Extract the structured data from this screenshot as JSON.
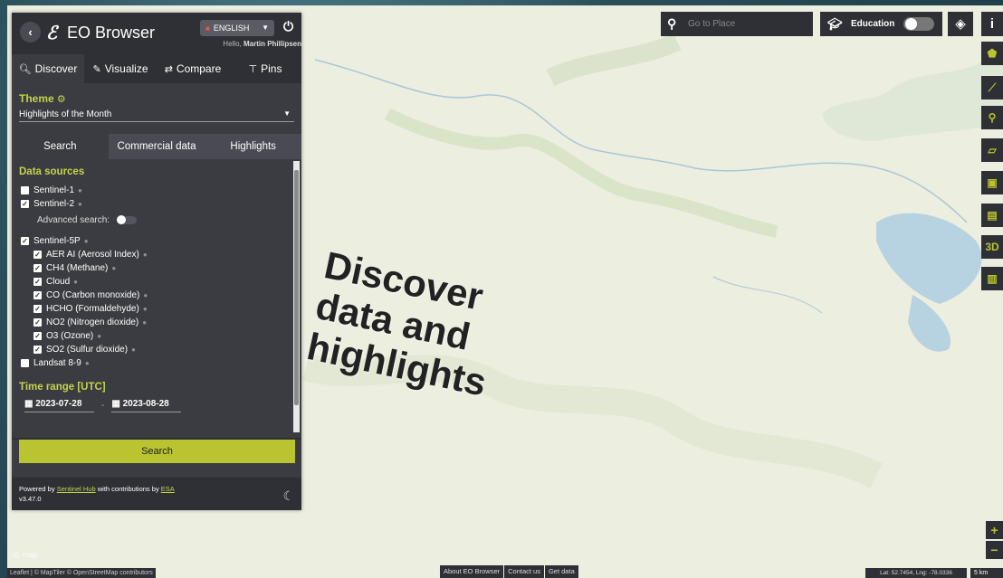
{
  "app": {
    "title": "EO Browser",
    "language": "ENGLISH",
    "greeting_prefix": "Hello, ",
    "user_name": "Martin Phillipsen"
  },
  "main_tabs": [
    {
      "label": "Discover",
      "icon": "search-icon"
    },
    {
      "label": "Visualize",
      "icon": "brush-icon"
    },
    {
      "label": "Compare",
      "icon": "compare-arrows-icon"
    },
    {
      "label": "Pins",
      "icon": "pin-icon"
    }
  ],
  "theme": {
    "label": "Theme",
    "selected": "Highlights of the Month"
  },
  "sub_tabs": [
    "Search",
    "Commercial data",
    "Highlights"
  ],
  "data_sources": {
    "title": "Data sources",
    "sentinel1": "Sentinel-1",
    "sentinel2": "Sentinel-2",
    "advanced_search": "Advanced search:",
    "sentinel5p": "Sentinel-5P",
    "s5p_items": [
      "AER AI (Aerosol Index)",
      "CH4 (Methane)",
      "Cloud",
      "CO (Carbon monoxide)",
      "HCHO (Formaldehyde)",
      "NO2 (Nitrogen dioxide)",
      "O3 (Ozone)",
      "SO2 (Sulfur dioxide)"
    ],
    "landsat": "Landsat 8-9"
  },
  "time_range": {
    "title": "Time range [UTC]",
    "from": "2023-07-28",
    "separator": "-",
    "to": "2023-08-28"
  },
  "search_button": "Search",
  "footer": {
    "powered_by": "Powered by ",
    "sentinel_hub": "Sentinel Hub",
    "contributions": " with contributions by ",
    "esa": "ESA",
    "version": "v3.47.0"
  },
  "overlay": {
    "line1": "Discover",
    "line2": "data and",
    "line3": "highlights"
  },
  "map_controls": {
    "place_placeholder": "Go to Place",
    "education": "Education",
    "tools": [
      "polygon-icon",
      "route-icon",
      "map-pin-icon",
      "ruler-icon",
      "image-download-icon",
      "film-icon",
      "3D",
      "chart-icon"
    ],
    "zoom_in": "+",
    "zoom_out": "−"
  },
  "bottom": {
    "attribution": "Leaflet | © MapTiler © OpenStreetMap contributors",
    "links": [
      "About EO Browser",
      "Contact us",
      "Get data"
    ],
    "coords": "Lat: 52.7454, Lng: -78.0336",
    "scale": "5 km",
    "map_logo": "map"
  }
}
